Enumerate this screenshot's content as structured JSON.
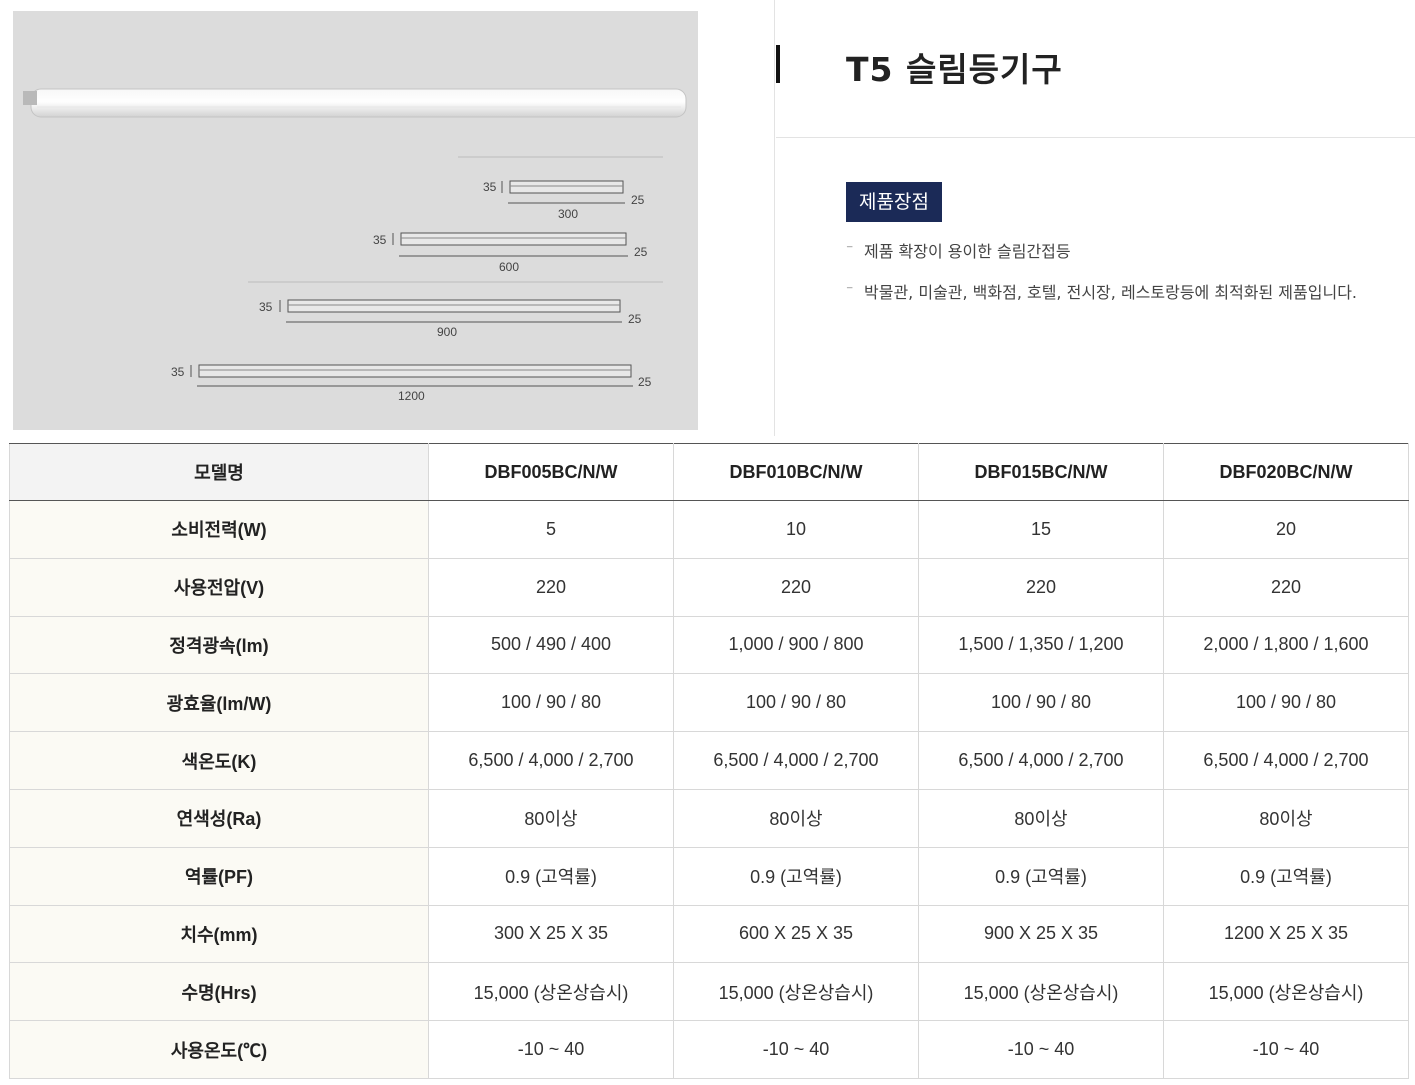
{
  "product": {
    "title": "T5 슬림등기구",
    "badge": "제품장점",
    "features": [
      "제품 확장이 용이한 슬림간접등",
      "박물관, 미술관, 백화점, 호텔, 전시장, 레스토랑등에 최적화된 제품입니다."
    ]
  },
  "diagram": {
    "sizes": [
      {
        "length": "300",
        "height": "35",
        "depth": "25"
      },
      {
        "length": "600",
        "height": "35",
        "depth": "25"
      },
      {
        "length": "900",
        "height": "35",
        "depth": "25"
      },
      {
        "length": "1200",
        "height": "35",
        "depth": "25"
      }
    ]
  },
  "spec_table": {
    "header": [
      "모델명",
      "DBF005BC/N/W",
      "DBF010BC/N/W",
      "DBF015BC/N/W",
      "DBF020BC/N/W"
    ],
    "rows": [
      {
        "label": "소비전력(W)",
        "values": [
          "5",
          "10",
          "15",
          "20"
        ]
      },
      {
        "label": "사용전압(V)",
        "values": [
          "220",
          "220",
          "220",
          "220"
        ]
      },
      {
        "label": "정격광속(lm)",
        "values": [
          "500 / 490 / 400",
          "1,000 / 900 / 800",
          "1,500 / 1,350 / 1,200",
          "2,000 / 1,800 / 1,600"
        ]
      },
      {
        "label": "광효율(lm/W)",
        "values": [
          "100 / 90 / 80",
          "100 / 90 / 80",
          "100 / 90 / 80",
          "100 / 90 / 80"
        ]
      },
      {
        "label": "색온도(K)",
        "values": [
          "6,500 / 4,000 / 2,700",
          "6,500 / 4,000 / 2,700",
          "6,500 / 4,000 / 2,700",
          "6,500 / 4,000 / 2,700"
        ]
      },
      {
        "label": "연색성(Ra)",
        "values": [
          "80이상",
          "80이상",
          "80이상",
          "80이상"
        ]
      },
      {
        "label": "역률(PF)",
        "values": [
          "0.9 (고역률)",
          "0.9 (고역률)",
          "0.9 (고역률)",
          "0.9 (고역률)"
        ]
      },
      {
        "label": "치수(mm)",
        "values": [
          "300 X 25 X 35",
          "600 X 25 X 35",
          "900 X 25 X 35",
          "1200 X 25 X 35"
        ]
      },
      {
        "label": "수명(Hrs)",
        "values": [
          "15,000 (상온상습시)",
          "15,000 (상온상습시)",
          "15,000 (상온상습시)",
          "15,000 (상온상습시)"
        ]
      },
      {
        "label": "사용온도(℃)",
        "values": [
          "-10 ~ 40",
          "-10 ~ 40",
          "-10 ~ 40",
          "-10 ~ 40"
        ]
      }
    ]
  }
}
